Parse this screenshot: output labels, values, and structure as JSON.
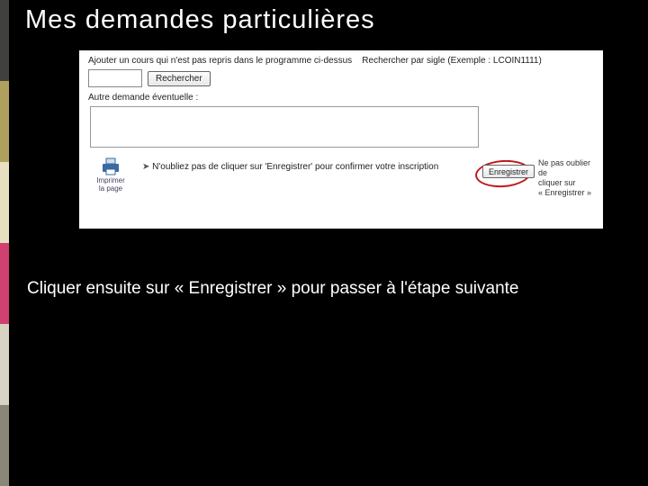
{
  "slide": {
    "title": "Mes demandes particulières",
    "instruction": "Cliquer ensuite sur « Enregistrer » pour passer à l'étape suivante"
  },
  "panel": {
    "add_course_label": "Ajouter un cours qui n'est pas repris dans le programme ci-dessus",
    "search_hint": "Rechercher par sigle (Exemple : LCOIN1111)",
    "search_button": "Rechercher",
    "other_request_label": "Autre demande éventuelle :",
    "print_label_1": "Imprimer",
    "print_label_2": "la page",
    "reminder": "N'oubliez pas de cliquer sur 'Enregistrer' pour confirmer votre inscription",
    "save_button": "Enregistrer",
    "side_note_1": "Ne pas oublier de",
    "side_note_2": "cliquer sur",
    "side_note_3": "« Enregistrer »"
  }
}
